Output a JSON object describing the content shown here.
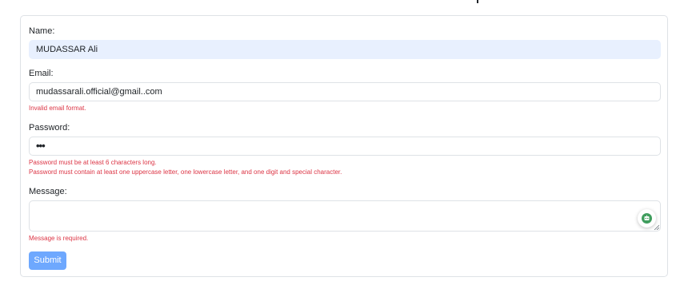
{
  "form": {
    "name_label": "Name:",
    "name_value": "MUDASSAR Ali",
    "email_label": "Email:",
    "email_value": "mudassarali.official@gmail..com",
    "email_error": "Invalid email format.",
    "password_label": "Password:",
    "password_value": "•••",
    "password_error_length": "Password must be at least 6 characters long.",
    "password_error_complexity": "Password must contain at least one uppercase letter, one lowercase letter, and one digit and special character.",
    "message_label": "Message:",
    "message_value": "",
    "message_error": "Message is required.",
    "submit_label": "Submit"
  },
  "colors": {
    "error": "#dc3545",
    "submit_button": "#6ea8fe",
    "autofill_background": "#e8f0fe",
    "assistant_icon": "#3f9d5d"
  },
  "icons": {
    "assistant": "robot-assistant-icon",
    "resize": "resize-handle-icon"
  }
}
